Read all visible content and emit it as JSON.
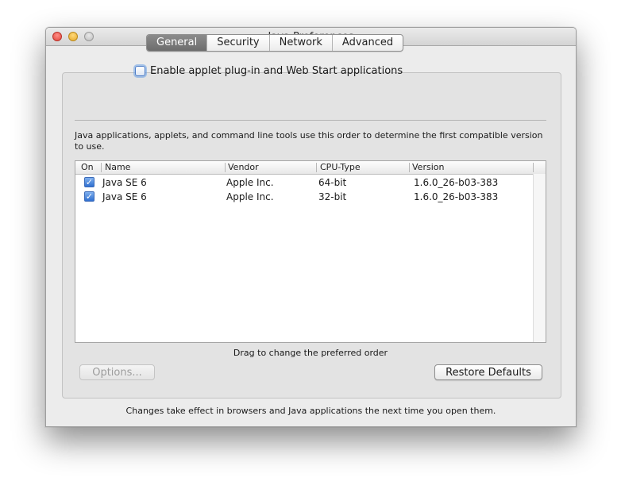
{
  "window": {
    "title": "Java Preferences"
  },
  "tabs": [
    {
      "label": "General",
      "active": true
    },
    {
      "label": "Security",
      "active": false
    },
    {
      "label": "Network",
      "active": false
    },
    {
      "label": "Advanced",
      "active": false
    }
  ],
  "general": {
    "enable_label": "Enable applet plug-in and Web Start applications",
    "enable_checked": false,
    "description": "Java applications, applets, and command line tools use this order to determine the first compatible version to use.",
    "table": {
      "headers": [
        "On",
        "Name",
        "Vendor",
        "CPU-Type",
        "Version"
      ],
      "rows": [
        {
          "on": true,
          "name": "Java SE 6",
          "vendor": "Apple Inc.",
          "cpu": "64-bit",
          "version": "1.6.0_26-b03-383"
        },
        {
          "on": true,
          "name": "Java SE 6",
          "vendor": "Apple Inc.",
          "cpu": "32-bit",
          "version": "1.6.0_26-b03-383"
        }
      ]
    },
    "drag_hint": "Drag to change the preferred order",
    "options_label": "Options...",
    "restore_label": "Restore Defaults",
    "checkmark": "✓"
  },
  "footer": "Changes take effect in browsers and Java applications the next time you open them."
}
